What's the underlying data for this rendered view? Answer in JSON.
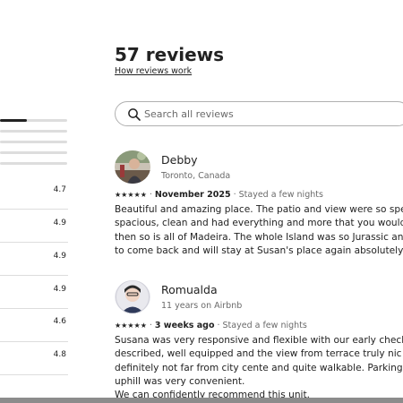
{
  "header": {
    "title": "57 reviews",
    "how_link": "How reviews work"
  },
  "search": {
    "placeholder": "Search all reviews",
    "value": ""
  },
  "rating_breakdown": {
    "bars": [
      0.4,
      0,
      0,
      0,
      0
    ]
  },
  "categories": [
    {
      "value": "4.7"
    },
    {
      "value": "4.9"
    },
    {
      "value": "4.9"
    },
    {
      "value": "4.9"
    },
    {
      "value": "4.6"
    },
    {
      "value": "4.8"
    }
  ],
  "reviews": [
    {
      "name": "Debby",
      "subtitle": "Toronto, Canada",
      "stars": "★★★★★",
      "date": "November 2025",
      "stay": "Stayed a few nights",
      "text": "Beautiful and amazing place. The patio and view were so spe\nspacious, clean and had everything and more that you would\nthen so is all of Madeira. The whole Island was so Jurassic an\nto come back and will stay at Susan's place again absolutely."
    },
    {
      "name": "Romualda",
      "subtitle": "11 years on Airbnb",
      "stars": "★★★★★",
      "date": "3 weeks ago",
      "stay": "Stayed a few nights",
      "text": "Susana was very responsive and flexible with our early check\ndescribed, well equipped and the view from terrace truly nic\ndefinitely not far from city cente and quite walkable. Parking\nuphill was very convenient.\nWe can confidently recommend this unit."
    }
  ],
  "colors": {
    "text": "#222222",
    "muted": "#6a6a6a",
    "border": "#dddddd"
  },
  "icons": {
    "search": "search-icon"
  }
}
